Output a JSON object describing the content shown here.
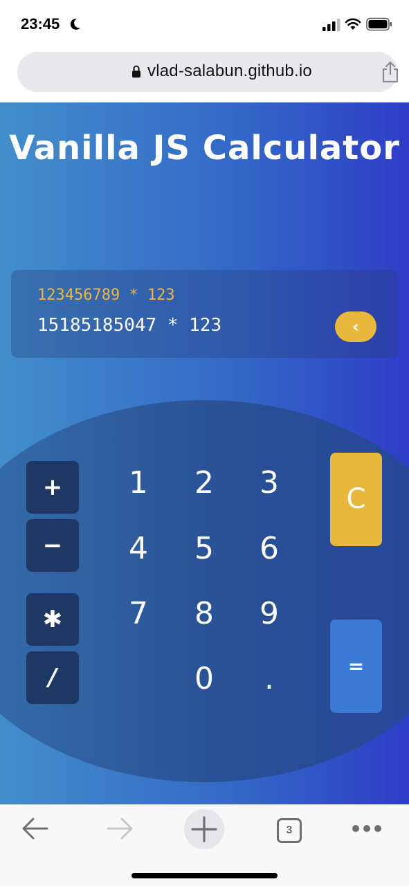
{
  "status_bar": {
    "time": "23:45",
    "icons": [
      "moon-icon",
      "cellular-signal-icon",
      "wifi-icon",
      "battery-icon"
    ]
  },
  "browser": {
    "url": "vlad-salabun.github.io",
    "icons": [
      "lock-icon",
      "share-icon"
    ]
  },
  "app": {
    "title": "Vanilla JS Calculator",
    "display": {
      "previous_expression": "123456789 * 123",
      "current_expression": "15185185047 * 123",
      "backspace_label": "‹"
    },
    "operators": [
      "+",
      "−",
      "✱",
      "/"
    ],
    "digits": [
      "1",
      "2",
      "3",
      "4",
      "5",
      "6",
      "7",
      "8",
      "9",
      "0",
      "."
    ],
    "clear_label": "C",
    "equals_label": "=",
    "colors": {
      "accent_yellow": "#e8b83c",
      "equals_blue": "#3a7ad6",
      "operator_bg": "#1f3763",
      "previous_text": "#f0b53a"
    }
  },
  "bottom_bar": {
    "tab_count": "3",
    "icons": [
      "back-arrow-icon",
      "forward-arrow-icon",
      "new-tab-plus-icon",
      "tabs-icon",
      "more-icon"
    ]
  }
}
